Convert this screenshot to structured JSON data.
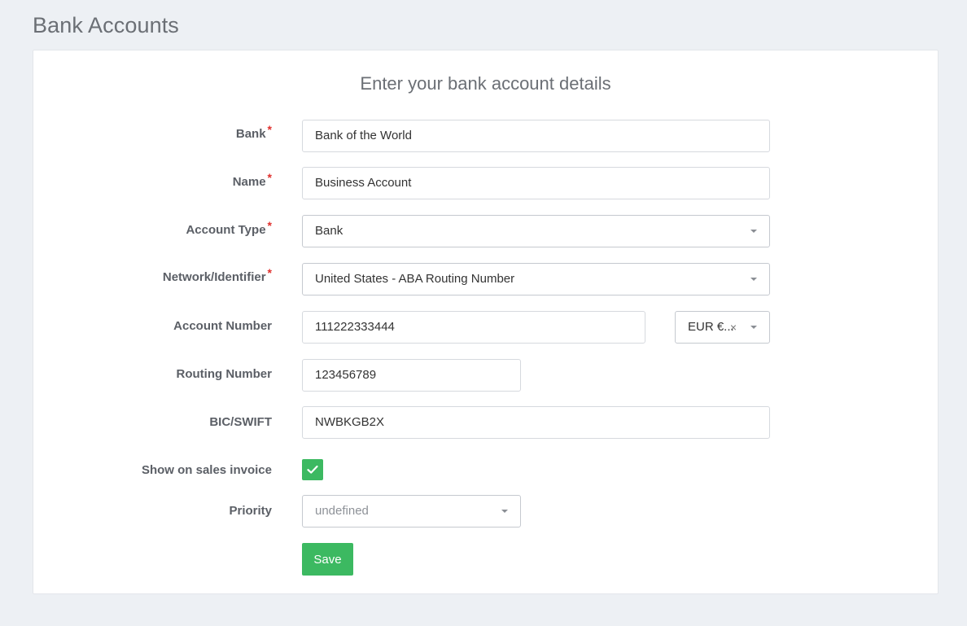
{
  "page": {
    "title": "Bank Accounts"
  },
  "form": {
    "heading": "Enter your bank account details",
    "bank": {
      "label": "Bank",
      "value": "Bank of the World"
    },
    "name": {
      "label": "Name",
      "value": "Business Account"
    },
    "account_type": {
      "label": "Account Type",
      "value": "Bank"
    },
    "network": {
      "label": "Network/Identifier",
      "value": "United States - ABA Routing Number"
    },
    "account_number": {
      "label": "Account Number",
      "value": "111222333444",
      "currency": "EUR €...",
      "clear": "×"
    },
    "routing_number": {
      "label": "Routing Number",
      "value": "123456789"
    },
    "bic": {
      "label": "BIC/SWIFT",
      "value": "NWBKGB2X"
    },
    "show_on_invoice": {
      "label": "Show on sales invoice",
      "checked": true
    },
    "priority": {
      "label": "Priority",
      "value": "undefined"
    },
    "required_mark": "*",
    "save_label": "Save"
  },
  "colors": {
    "accent": "#3cb961",
    "required": "#e0302d",
    "background": "#edf0f4"
  },
  "icons": {
    "dropdown": "chevron-down-icon",
    "check": "check-icon"
  }
}
